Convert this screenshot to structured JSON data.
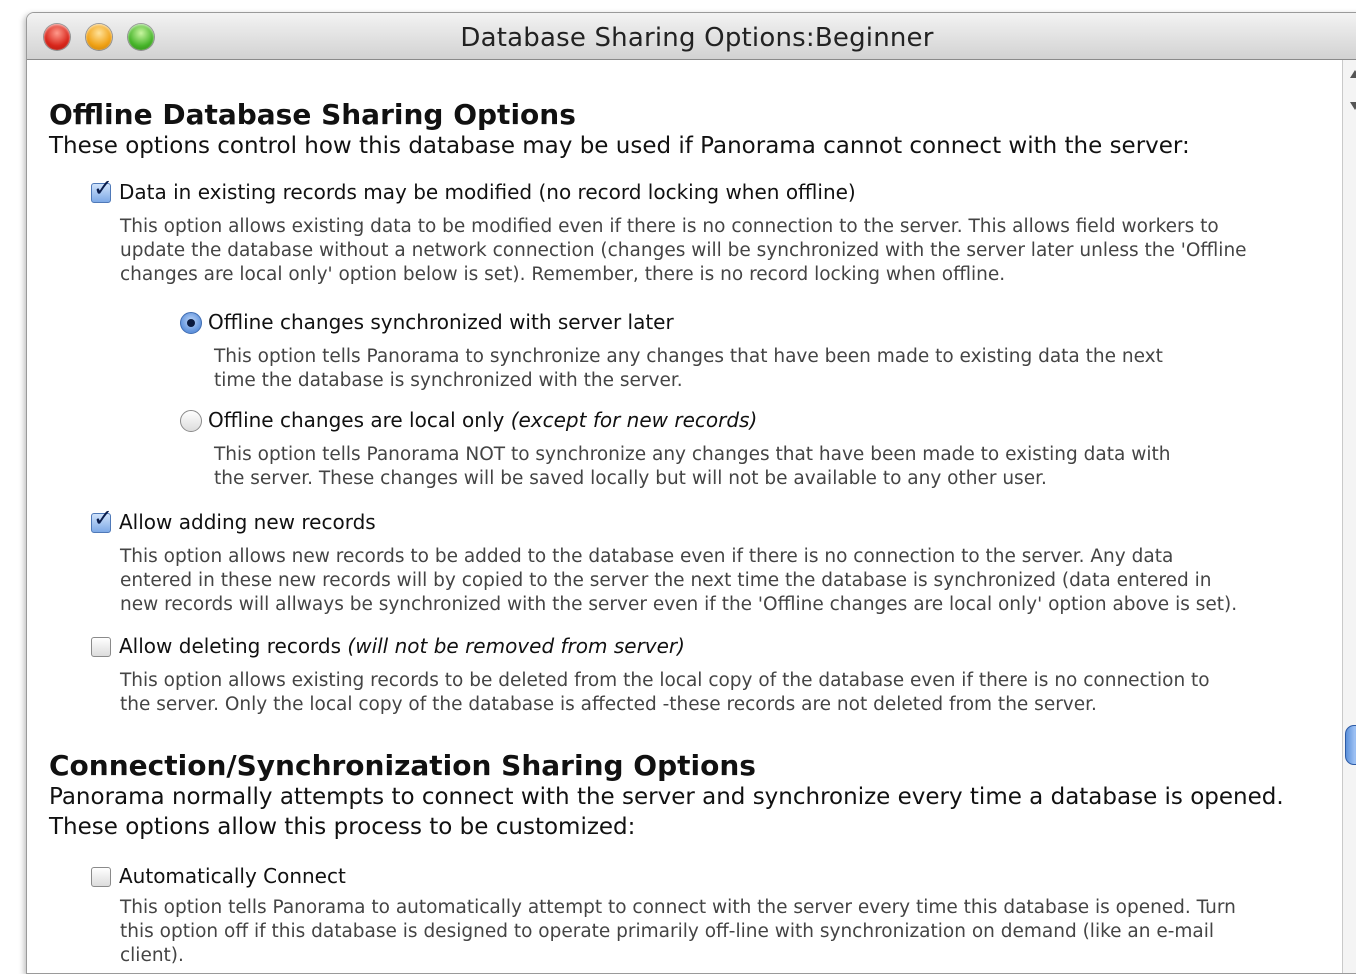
{
  "window": {
    "title": "Database Sharing Options:Beginner"
  },
  "offline": {
    "heading": "Offline Database Sharing Options",
    "intro": "These options control how this database may be used if Panorama cannot connect with the server:",
    "modify": {
      "label": "Data in existing records may be modified (no record locking when offline)",
      "checked": true,
      "desc": [
        "This option allows existing data to be modified even if there is no connection to the server. This allows field workers to",
        "update the database without a network connection (changes will be synchronized with the server later unless the 'Offline",
        "changes are local only' option below is set). Remember, there is no record locking when offline."
      ]
    },
    "sync_later": {
      "label": "Offline changes synchronized with server later",
      "selected": true,
      "desc": [
        "This option tells Panorama to synchronize any changes that have been made to existing data the next",
        "time the database is synchronized with the server."
      ]
    },
    "local_only": {
      "label": "Offline changes are local only",
      "label_note": "(except for new records)",
      "selected": false,
      "desc": [
        "This option tells Panorama NOT to synchronize any changes that have been made to existing data with",
        "the server. These changes will be saved locally but will not be available to any other user."
      ]
    },
    "add_records": {
      "label": "Allow adding new records",
      "checked": true,
      "desc": [
        "This option allows new records to be added to the database even if there is no connection to the server. Any data",
        "entered in these new records will by copied to the server the next time the database is synchronized (data entered in",
        "new records will allways be synchronized with the server even if the 'Offline changes are local only' option above is set)."
      ]
    },
    "delete_records": {
      "label": "Allow deleting records",
      "label_note": "(will not be removed from server)",
      "checked": false,
      "desc": [
        "This option allows existing records to be deleted from the local copy of the database even if there is no connection to",
        "the server. Only the local copy of the database is affected -these records are not deleted from the server."
      ]
    }
  },
  "connection": {
    "heading": "Connection/Synchronization Sharing Options",
    "intro": [
      "Panorama normally attempts to connect with the server and synchronize every time a database is opened.",
      "These options allow this process to be customized:"
    ],
    "auto_connect": {
      "label": "Automatically Connect",
      "checked": false,
      "desc": [
        "This option tells Panorama to automatically attempt to connect with the server every time this database is opened. Turn",
        "this option off if this database is designed to operate primarily off-line with synchronization on demand (like an e-mail",
        "client)."
      ]
    }
  }
}
